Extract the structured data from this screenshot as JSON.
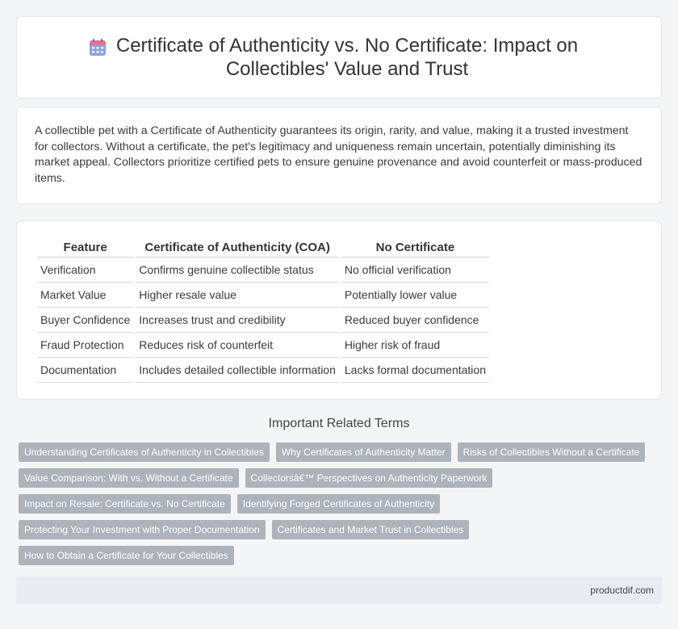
{
  "header": {
    "title": "Certificate of Authenticity vs. No Certificate: Impact on Collectibles' Value and Trust",
    "icon": "calendar-icon"
  },
  "intro": {
    "text": "A collectible pet with a Certificate of Authenticity guarantees its origin, rarity, and value, making it a trusted investment for collectors. Without a certificate, the pet's legitimacy and uniqueness remain uncertain, potentially diminishing its market appeal. Collectors prioritize certified pets to ensure genuine provenance and avoid counterfeit or mass-produced items."
  },
  "table": {
    "headers": [
      "Feature",
      "Certificate of Authenticity (COA)",
      "No Certificate"
    ],
    "rows": [
      [
        "Verification",
        "Confirms genuine collectible status",
        "No official verification"
      ],
      [
        "Market Value",
        "Higher resale value",
        "Potentially lower value"
      ],
      [
        "Buyer Confidence",
        "Increases trust and credibility",
        "Reduced buyer confidence"
      ],
      [
        "Fraud Protection",
        "Reduces risk of counterfeit",
        "Higher risk of fraud"
      ],
      [
        "Documentation",
        "Includes detailed collectible information",
        "Lacks formal documentation"
      ]
    ]
  },
  "related": {
    "title": "Important Related Terms",
    "tags": [
      "Understanding Certificates of Authenticity in Collectibles",
      "Why Certificates of Authenticity Matter",
      "Risks of Collectibles Without a Certificate",
      "Value Comparison: With vs. Without a Certificate",
      "Collectorsâ€™ Perspectives on Authenticity Paperwork",
      "Impact on Resale: Certificate vs. No Certificate",
      "Identifying Forged Certificates of Authenticity",
      "Protecting Your Investment with Proper Documentation",
      "Certificates and Market Trust in Collectibles",
      "How to Obtain a Certificate for Your Collectibles"
    ]
  },
  "footer": {
    "site": "productdif.com"
  },
  "colors": {
    "icon_top": "#e26d8a",
    "icon_body": "#7b93d6",
    "tag_bg": "#adb3ba",
    "footer_bg": "#e8ecf2"
  }
}
